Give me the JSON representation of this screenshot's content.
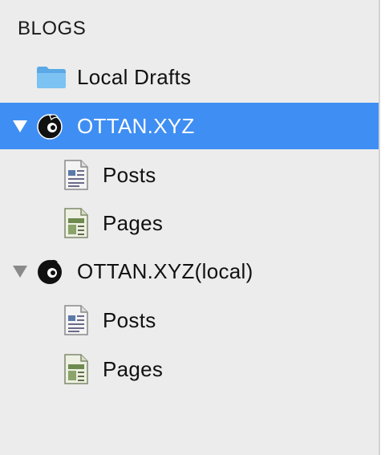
{
  "sidebar": {
    "section_header": "BLOGS",
    "local_drafts": {
      "label": "Local Drafts",
      "icon": "folder-icon"
    },
    "blogs": [
      {
        "name": "OTTAN.XYZ",
        "selected": true,
        "expanded": true,
        "icon": "blog-logo-icon",
        "children": [
          {
            "label": "Posts",
            "icon": "posts-document-icon"
          },
          {
            "label": "Pages",
            "icon": "pages-document-icon"
          }
        ]
      },
      {
        "name": "OTTAN.XYZ(local)",
        "selected": false,
        "expanded": true,
        "icon": "blog-logo-icon",
        "children": [
          {
            "label": "Posts",
            "icon": "posts-document-icon"
          },
          {
            "label": "Pages",
            "icon": "pages-document-icon"
          }
        ]
      }
    ]
  },
  "colors": {
    "sidebar_background": "#ececec",
    "selection": "#3f8ef3",
    "selected_text": "#ffffff",
    "text": "#111111",
    "folder_blue": "#6fb8ec"
  }
}
